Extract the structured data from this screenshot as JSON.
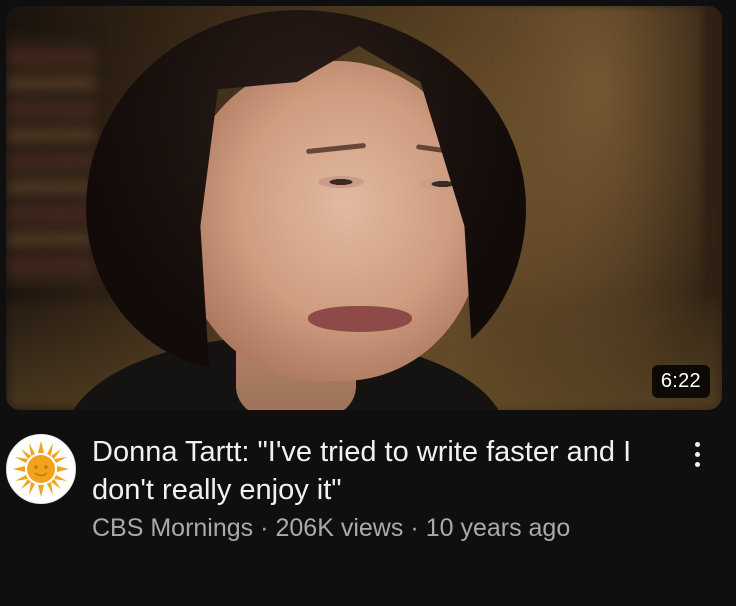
{
  "video": {
    "duration": "6:22",
    "title": "Donna Tartt: \"I've tried to write faster and I don't really enjoy it\"",
    "channel": "CBS Mornings",
    "views": "206K views",
    "age": "10 years ago",
    "separator": "·"
  },
  "icons": {
    "avatar": "cbs-sun-logo-icon",
    "menu": "more-vertical-icon"
  },
  "colors": {
    "background": "#0f0f0f",
    "title": "#f1f1f1",
    "meta": "#aaaaaa",
    "sun_logo": "#f2a31c"
  }
}
